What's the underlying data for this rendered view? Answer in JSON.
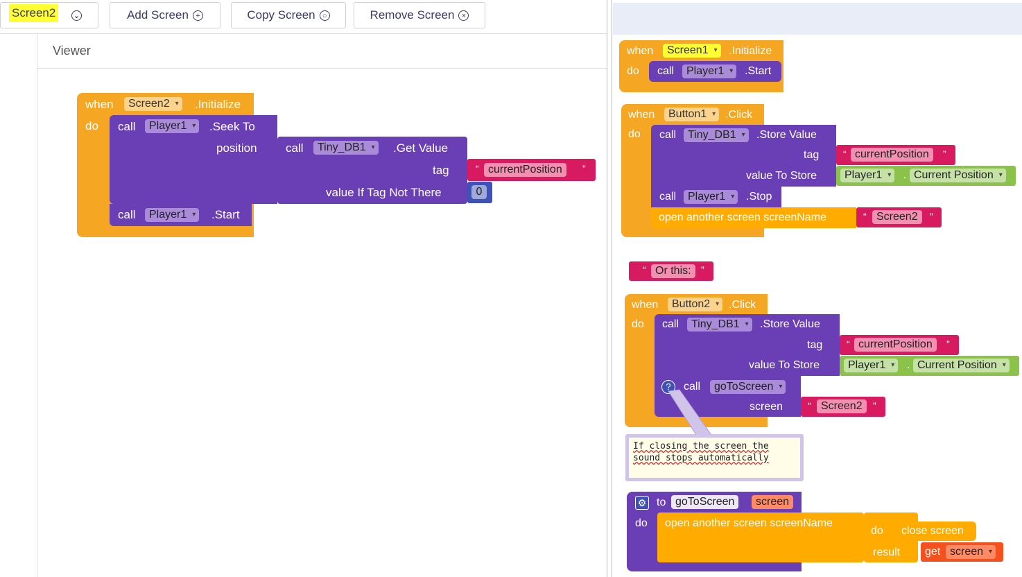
{
  "toolbar": {
    "screen_select": "Screen2",
    "add_screen": "Add Screen",
    "copy_screen": "Copy Screen",
    "remove_screen": "Remove Screen"
  },
  "viewer": {
    "title": "Viewer"
  },
  "left_blocks": {
    "when": "when",
    "component": "Screen2",
    "event": ".Initialize",
    "do": "do",
    "call1": "call",
    "player1": "Player1",
    "seek_to": ".Seek To",
    "position": "position",
    "call2": "call",
    "tinydb": "Tiny_DB1",
    "get_value": ".Get Value",
    "tag": "tag",
    "tag_value": "currentPosition",
    "if_not_there": "value If Tag Not There",
    "zero": "0",
    "call3": "call",
    "player1b": "Player1",
    "start": ".Start"
  },
  "right": {
    "b1": {
      "when": "when",
      "component": "Screen1",
      "event": ".Initialize",
      "do": "do",
      "call": "call",
      "player": "Player1",
      "method": ".Start"
    },
    "b2": {
      "when": "when",
      "component": "Button1",
      "event": ".Click",
      "do": "do",
      "call": "call",
      "tinydb": "Tiny_DB1",
      "method": ".Store Value",
      "tag": "tag",
      "tag_value": "currentPosition",
      "value_to_store": "value To Store",
      "player": "Player1",
      "current_position": "Current Position",
      "call2": "call",
      "player2": "Player1",
      "stop": ".Stop",
      "open": "open another screen  screenName",
      "screen_value": "Screen2"
    },
    "or_this": "Or this:",
    "b3": {
      "when": "when",
      "component": "Button2",
      "event": ".Click",
      "do": "do",
      "call": "call",
      "tinydb": "Tiny_DB1",
      "method": ".Store Value",
      "tag": "tag",
      "tag_value": "currentPosition",
      "value_to_store": "value To Store",
      "player": "Player1",
      "current_position": "Current Position",
      "call2": "call",
      "proc": "goToScreen",
      "screen": "screen",
      "screen_value": "Screen2",
      "help": "?"
    },
    "comment": "If closing the screen the sound stops automatically",
    "b4": {
      "to": "to",
      "proc": "goToScreen",
      "param": "screen",
      "do": "do",
      "open": "open another screen  screenName",
      "do2": "do",
      "close": "close screen",
      "result": "result",
      "get": "get",
      "get_var": "screen"
    }
  },
  "colors": {
    "event": "#f5a623",
    "procedure": "#6a3fb5",
    "text": "#d81b60",
    "component": "#8bc34a",
    "math": "#3f51b5",
    "variable": "#f4511e"
  }
}
